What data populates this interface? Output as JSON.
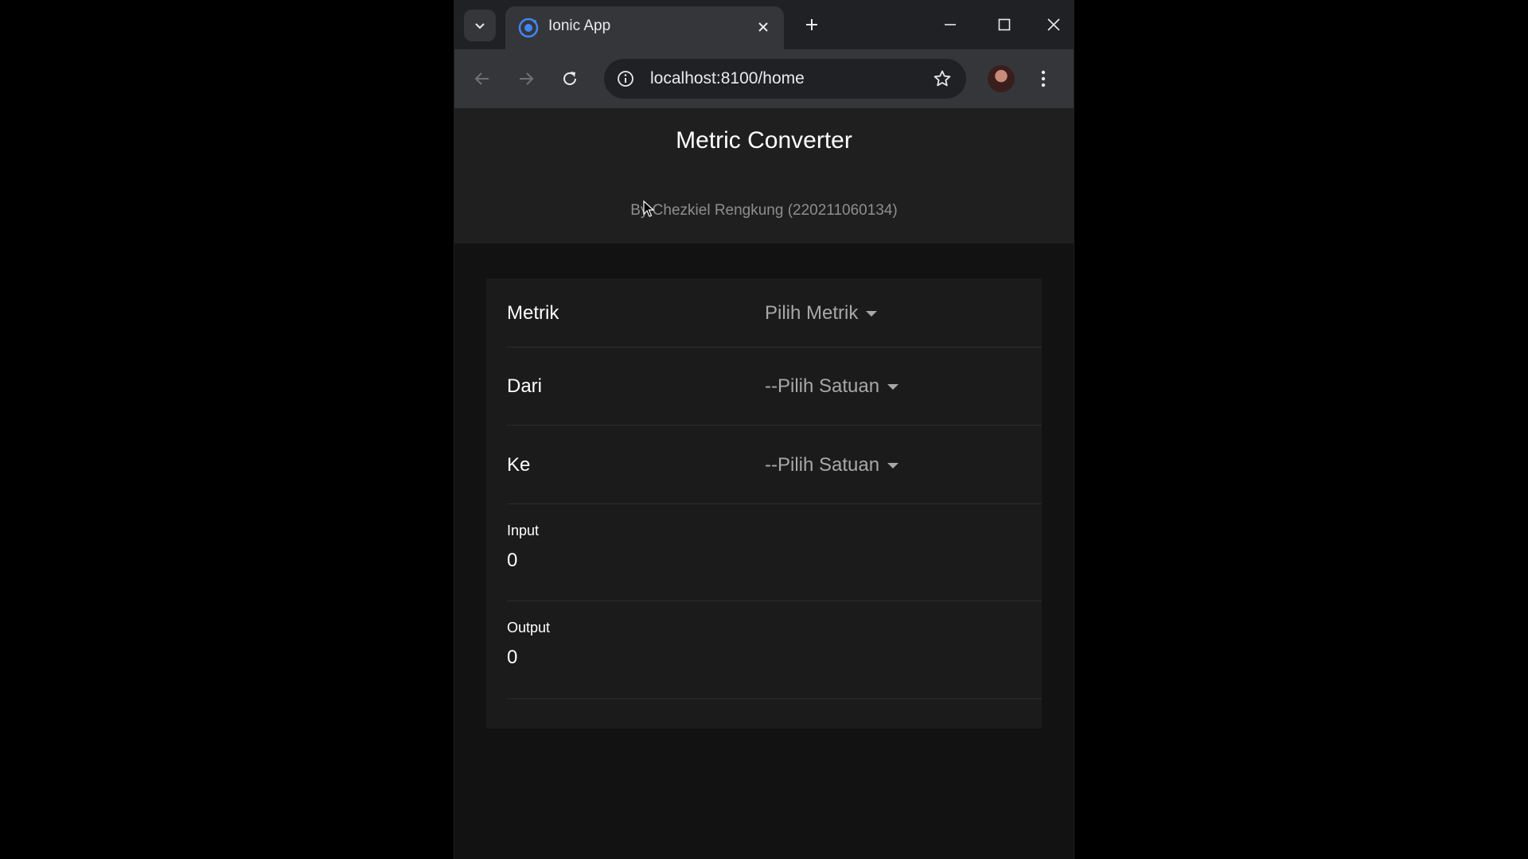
{
  "browser": {
    "tab_title": "Ionic App",
    "url": "localhost:8100/home",
    "icons": {
      "tab_list": "chevron-down-icon",
      "tab_favicon": "ionic-icon",
      "tab_close": "close-icon",
      "new_tab": "plus-icon",
      "minimize": "minimize-icon",
      "maximize": "maximize-icon",
      "close_window": "close-icon",
      "back": "arrow-left-icon",
      "forward": "arrow-right-icon",
      "reload": "reload-icon",
      "site_info": "info-icon",
      "bookmark": "star-icon",
      "profile": "avatar",
      "menu": "kebab-menu-icon"
    }
  },
  "page": {
    "title": "Metric Converter",
    "subtitle": "By Chezkiel Rengkung (220211060134)"
  },
  "form": {
    "metric": {
      "label": "Metrik",
      "value": "Pilih Metrik"
    },
    "from": {
      "label": "Dari",
      "value": "--Pilih Satuan"
    },
    "to": {
      "label": "Ke",
      "value": "--Pilih Satuan"
    },
    "input": {
      "label": "Input",
      "value": "0"
    },
    "output": {
      "label": "Output",
      "value": "0"
    }
  },
  "colors": {
    "accent": "#4285f4",
    "background": "#000000",
    "page_background": "#121212",
    "header_background": "#1f1f1f"
  }
}
